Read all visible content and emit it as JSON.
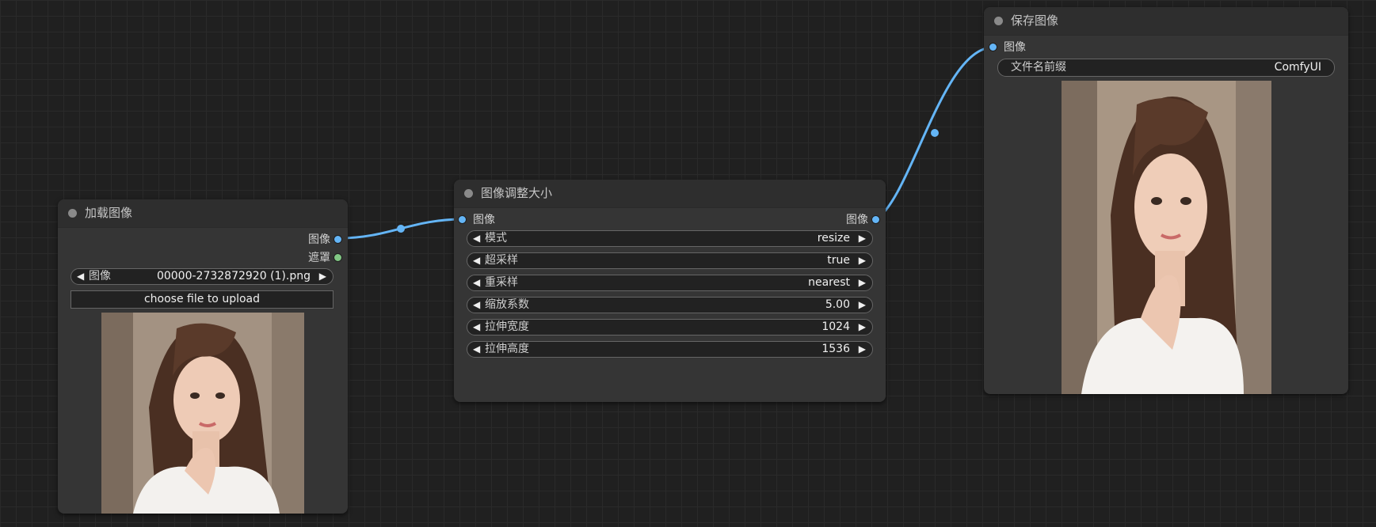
{
  "load_node": {
    "title": "加载图像",
    "outputs": [
      "图像",
      "遮罩"
    ],
    "image_widget": {
      "label": "图像",
      "value": "00000-2732872920 (1).png"
    },
    "upload_button": "choose file to upload"
  },
  "resize_node": {
    "title": "图像调整大小",
    "input": "图像",
    "output": "图像",
    "widgets": [
      {
        "label": "模式",
        "value": "resize"
      },
      {
        "label": "超采样",
        "value": "true"
      },
      {
        "label": "重采样",
        "value": "nearest"
      },
      {
        "label": "缩放系数",
        "value": "5.00"
      },
      {
        "label": "拉伸宽度",
        "value": "1024"
      },
      {
        "label": "拉伸高度",
        "value": "1536"
      }
    ]
  },
  "save_node": {
    "title": "保存图像",
    "input": "图像",
    "prefix_widget": {
      "label": "文件名前缀",
      "value": "ComfyUI"
    }
  },
  "colors": {
    "canvas": "#202020",
    "node_body": "#353535",
    "image_link": "#64b5f6",
    "mask_slot": "#81c784"
  }
}
